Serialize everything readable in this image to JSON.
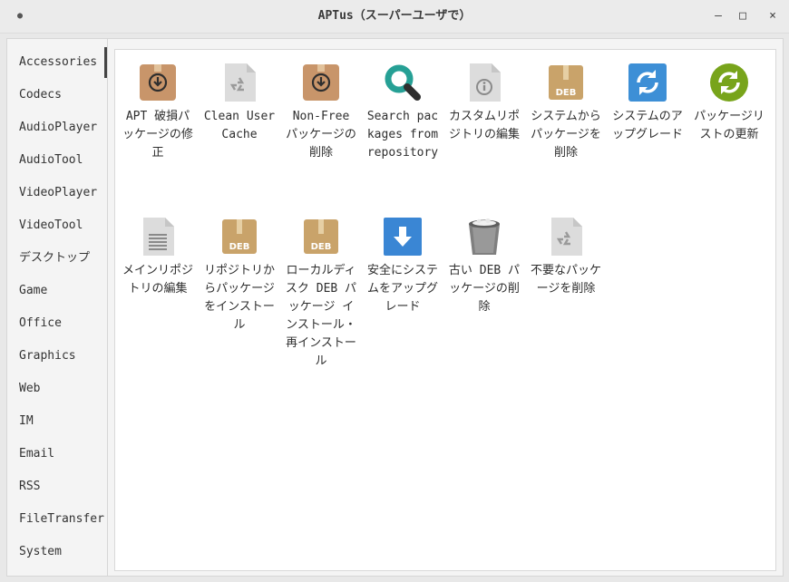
{
  "window": {
    "title": "APTus（スーパーユーザで）",
    "menu_icon": "dot-icon",
    "minimize_label": "–",
    "maximize_label": "□",
    "close_label": "×"
  },
  "sidebar": {
    "items": [
      {
        "label": "Accessories"
      },
      {
        "label": "Codecs"
      },
      {
        "label": "AudioPlayer"
      },
      {
        "label": "AudioTool"
      },
      {
        "label": "VideoPlayer"
      },
      {
        "label": "VideoTool"
      },
      {
        "label": "デスクトップ"
      },
      {
        "label": "Game"
      },
      {
        "label": "Office"
      },
      {
        "label": "Graphics"
      },
      {
        "label": "Web"
      },
      {
        "label": "IM"
      },
      {
        "label": "Email"
      },
      {
        "label": "RSS"
      },
      {
        "label": "FileTransfer"
      },
      {
        "label": "System"
      }
    ],
    "active": "Accessories"
  },
  "apps": [
    {
      "label": "APT 破損パッケージの修正",
      "icon": "package-download-icon"
    },
    {
      "label": "Clean User Cache",
      "icon": "recycle-file-icon"
    },
    {
      "label": "Non-Free パッケージの削除",
      "icon": "package-download-icon"
    },
    {
      "label": "Search packages from repository",
      "icon": "search-icon"
    },
    {
      "label": "カスタムリポジトリの編集",
      "icon": "info-file-icon"
    },
    {
      "label": "システムからパッケージを削除",
      "icon": "deb-package-icon",
      "badge": "DEB"
    },
    {
      "label": "システムのアップグレード",
      "icon": "blue-refresh-icon"
    },
    {
      "label": "パッケージリストの更新",
      "icon": "green-refresh-icon"
    },
    {
      "label": "メインリポジトリの編集",
      "icon": "text-file-icon"
    },
    {
      "label": "リポジトリからパッケージをインストール",
      "icon": "deb-package-icon",
      "badge": "DEB"
    },
    {
      "label": "ローカルディスク DEB パッケージ インストール・再インストール",
      "icon": "deb-package-icon",
      "badge": "DEB"
    },
    {
      "label": "安全にシステムをアップグレード",
      "icon": "download-arrow-icon"
    },
    {
      "label": "古い DEB パッケージの削除",
      "icon": "trash-bin-icon"
    },
    {
      "label": "不要なパッケージを削除",
      "icon": "recycle-file-icon"
    }
  ],
  "colors": {
    "package_brown": "#c8956a",
    "deb_tan": "#c9a36a",
    "search_teal": "#26a095",
    "blue_refresh": "#3d8fd6",
    "green_refresh": "#78a41b",
    "download_blue": "#3a86d4",
    "file_gray": "#dcdcdc"
  }
}
